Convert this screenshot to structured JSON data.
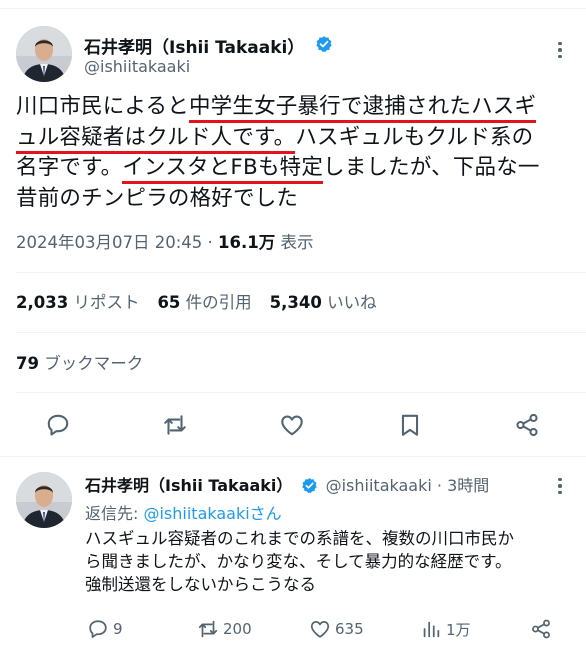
{
  "main_tweet": {
    "author_name": "石井孝明（Ishii Takaaki）",
    "author_handle": "@ishiitakaaki",
    "text_lines": [
      [
        "川口市民によると",
        "中学生女子暴行で逮捕されたハスギ"
      ],
      [
        "ュル容疑者はクルド人です。",
        "ハスギュルもクルド系の"
      ],
      [
        "名字です。",
        "インスタとFBも特定",
        "しましたが、下品な一"
      ],
      [
        "昔前のチンピラの格好でした"
      ]
    ],
    "timestamp": "2024年03月07日 20:45",
    "separator": " · ",
    "views_count": "16.1万",
    "views_label": " 表示",
    "reposts_count": "2,033",
    "reposts_label": "リポスト",
    "quotes_count": "65",
    "quotes_label": "件の引用",
    "likes_count": "5,340",
    "likes_label": "いいね",
    "bookmarks_count": "79",
    "bookmarks_label": "ブックマーク",
    "underline_color": "#e0141e"
  },
  "reply_tweet": {
    "author_name": "石井孝明（Ishii Takaaki）",
    "author_handle": "@ishiitakaaki",
    "time": "3時間",
    "reply_to_label": "返信先: ",
    "reply_to_handle": "@ishiitakaakiさん",
    "text_lines": [
      "ハスギュル容疑者のこれまでの系譜を、複数の川口市民か",
      "ら聞きましたが、かなり変な、そして暴力的な経歴です。",
      "強制送還をしないからこうなる"
    ],
    "replies": "9",
    "reposts": "200",
    "likes": "635",
    "views": "1万"
  },
  "icons": {
    "verified": "verified-badge-icon",
    "more": "more-icon",
    "reply": "reply-icon",
    "repost": "repost-icon",
    "like": "like-icon",
    "bookmark": "bookmark-icon",
    "share": "share-icon",
    "views": "views-icon"
  },
  "colors": {
    "verified_blue": "#1d9bf0",
    "secondary_text": "#536471",
    "primary_text": "#0f1419"
  }
}
